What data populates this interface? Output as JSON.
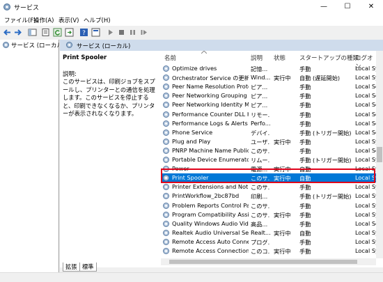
{
  "window": {
    "title": "サービス",
    "min": "—",
    "max": "☐",
    "close": "✕"
  },
  "menu": [
    "ファイル(F)",
    "操作(A)",
    "表示(V)",
    "ヘルプ(H)"
  ],
  "tree": {
    "root_label": "サービス (ローカル)"
  },
  "pane_header": "サービス (ローカル)",
  "selected_service": {
    "name": "Print Spooler",
    "desc_label": "説明:",
    "description": "このサービスは、印刷ジョブをスプールし、プリンターとの通信を処理します。このサービスを停止すると、印刷できなくなるか、プリンターが表示されなくなります。"
  },
  "columns": {
    "name": "名前",
    "desc": "説明",
    "status": "状態",
    "startup": "スタートアップの種類",
    "logon": "ログオン"
  },
  "rows": [
    {
      "name": "Optimize drives",
      "desc": "記憶...",
      "status": "",
      "startup": "手動",
      "logon": "Local Sy"
    },
    {
      "name": "Orchestrator Service の更新",
      "desc": "Wind...",
      "status": "実行中",
      "startup": "自動 (遅延開始)",
      "logon": "Local Sy"
    },
    {
      "name": "Peer Name Resolution Proto...",
      "desc": "ピア...",
      "status": "",
      "startup": "手動",
      "logon": "Local Se"
    },
    {
      "name": "Peer Networking Grouping",
      "desc": "ピア...",
      "status": "",
      "startup": "手動",
      "logon": "Local Se"
    },
    {
      "name": "Peer Networking Identity Ma...",
      "desc": "ピア...",
      "status": "",
      "startup": "手動",
      "logon": "Local Se"
    },
    {
      "name": "Performance Counter DLL Host",
      "desc": "リモー...",
      "status": "",
      "startup": "手動",
      "logon": "Local Se"
    },
    {
      "name": "Performance Logs & Alerts",
      "desc": "Perfo...",
      "status": "",
      "startup": "手動",
      "logon": "Local Se"
    },
    {
      "name": "Phone Service",
      "desc": "デバイ...",
      "status": "",
      "startup": "手動 (トリガー開始)",
      "logon": "Local Se"
    },
    {
      "name": "Plug and Play",
      "desc": "ユーザ...",
      "status": "実行中",
      "startup": "手動",
      "logon": "Local Sy"
    },
    {
      "name": "PNRP Machine Name Publica...",
      "desc": "このサ...",
      "status": "",
      "startup": "手動",
      "logon": "Local Se"
    },
    {
      "name": "Portable Device Enumerator ...",
      "desc": "リムー...",
      "status": "",
      "startup": "手動 (トリガー開始)",
      "logon": "Local Sy"
    },
    {
      "name": "Power",
      "desc": "電源...",
      "status": "実行中",
      "startup": "自動",
      "logon": "Local Sy"
    },
    {
      "name": "Print Spooler",
      "desc": "このサ...",
      "status": "実行中",
      "startup": "自動",
      "logon": "Local Sy"
    },
    {
      "name": "Printer Extensions and Notifi...",
      "desc": "このサ...",
      "status": "",
      "startup": "手動",
      "logon": "Local Sy"
    },
    {
      "name": "PrintWorkflow_2bc87bd",
      "desc": "印刷...",
      "status": "",
      "startup": "手動 (トリガー開始)",
      "logon": "Local Sy"
    },
    {
      "name": "Problem Reports Control Pan...",
      "desc": "このサ...",
      "status": "",
      "startup": "手動",
      "logon": "Local Sy"
    },
    {
      "name": "Program Compatibility Assist...",
      "desc": "このサ...",
      "status": "実行中",
      "startup": "手動",
      "logon": "Local Sy"
    },
    {
      "name": "Quality Windows Audio Vide...",
      "desc": "高品...",
      "status": "",
      "startup": "手動",
      "logon": "Local Se"
    },
    {
      "name": "Realtek Audio Universal Servi...",
      "desc": "Realt...",
      "status": "実行中",
      "startup": "自動",
      "logon": "Local Sy"
    },
    {
      "name": "Remote Access Auto Connecti...",
      "desc": "プログ...",
      "status": "",
      "startup": "手動",
      "logon": "Local Sy"
    },
    {
      "name": "Remote Access Connection ...",
      "desc": "このコ...",
      "status": "実行中",
      "startup": "手動",
      "logon": "Local Sy"
    }
  ],
  "tabs": [
    "拡張",
    "標準"
  ],
  "colors": {
    "selection": "#0078d7",
    "highlight_box": "#e0001a",
    "pane_header": "#cfdcec"
  }
}
